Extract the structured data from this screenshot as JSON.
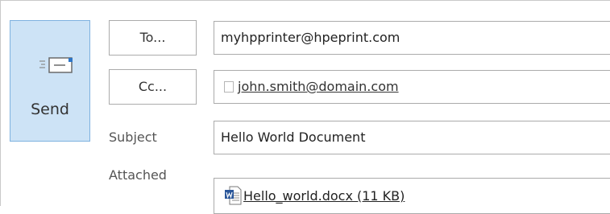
{
  "send": {
    "label": "Send",
    "icon": "send-envelope-icon"
  },
  "recipients": {
    "to_label": "To...",
    "to_value": "myhpprinter@hpeprint.com",
    "cc_label": "Cc...",
    "cc_value": "john.smith@domain.com"
  },
  "subject": {
    "label": "Subject",
    "value": "Hello World Document"
  },
  "attachment": {
    "label": "Attached",
    "file_name": "Hello_world.docx (11 KB)",
    "icon": "word-document-icon"
  },
  "colors": {
    "send_bg": "#cde3f6",
    "send_border": "#7fb2e0",
    "field_border": "#ababab",
    "word_blue": "#2b579a"
  }
}
